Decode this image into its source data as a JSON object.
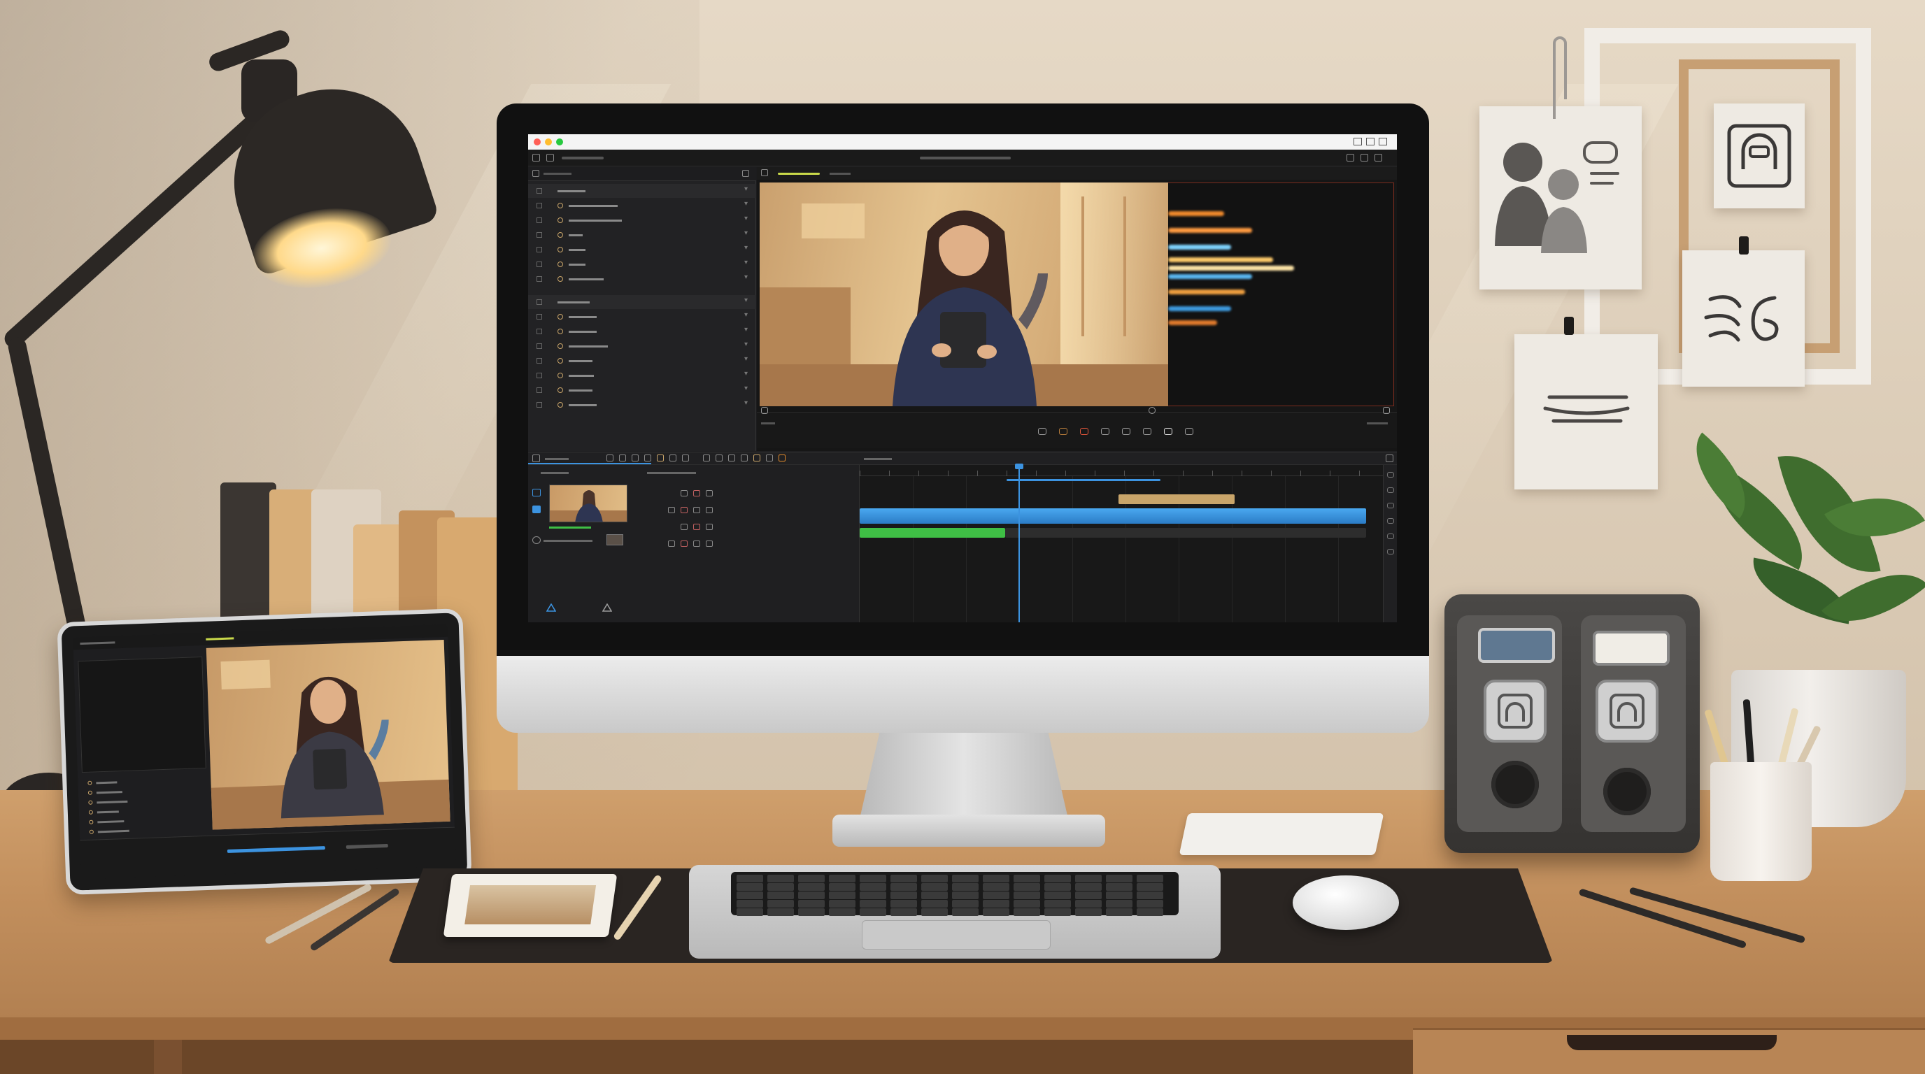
{
  "colors": {
    "accent_blue": "#3c93e0",
    "clip_gold": "#c9a56a",
    "clip_green": "#3fbf45",
    "frame_border": "#7a2b1e",
    "viewer_progress": "#c9d94a"
  },
  "app": {
    "window_title": "",
    "toolbar_center_text": "",
    "traffic_lights": [
      "close",
      "minimize",
      "zoom"
    ]
  },
  "timeline": {
    "playhead_position": 0.3
  },
  "icons": {
    "titlebar": [
      "minimize-icon",
      "maximize-icon",
      "close-icon"
    ],
    "viewer_controls": [
      "warning-icon",
      "camera-icon",
      "record-icon",
      "camera-icon",
      "camera-icon",
      "camera-icon",
      "subtitle-icon",
      "camera-icon"
    ]
  }
}
